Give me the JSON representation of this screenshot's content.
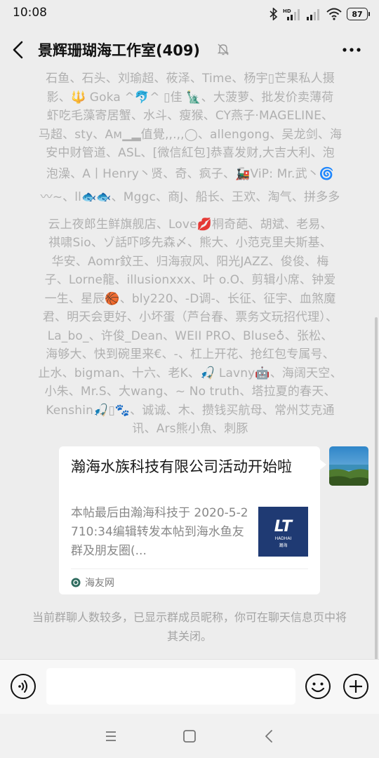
{
  "status_bar": {
    "time": "10:08",
    "battery": "87",
    "network": "HD"
  },
  "header": {
    "title": "景辉珊瑚海工作室(409)"
  },
  "members_text": [
    "石鱼、石头、刘瑜超、莜泽、Time、杨宇▯芒果私人摄",
    "影、🔱 Goka ^🐬^ ▯佳 🗽、大菠萝、批发价卖薄荷",
    "虾吃毛藻寄居蟹、水斗、瘦猴、CY燕子·MAGELINE、",
    "马超、sty、Aᴍ▁▂值覺,,.,,◯、allengong、吴龙剑、海",
    "安中财管道、ASL、[微信紅包]恭喜发财,大吉大利、泡",
    "泡澡、A丨Henry丶贤、奇、疯子、🚂ViP: Mr.武丶🌀",
    "〰~、ll🐟🐟、Mggc、商J、船长、王欢、淘气、拼多多",
    "云上夜郎生鲜旗舰店、Love💋桐奇葩、胡斌、老易、",
    "祺啸Sio、ゾ話吓哆先森〆、熊大、小范克里夫斯基、",
    "华安、Aomr鈫王、归海寂风、阳光JAZZ、俊俊、梅",
    "子、Lorne龍、illusionxxx、叶 o.O、剪辑小席、钟爱",
    "一生、星辰🏀、bly220、-D调-、长征、征宇、血煞魔",
    "君、明天会更好、小坏蛋（芦台春、票务文玩招代理）、",
    "La_bo_、许俊_Dean、WEII PRO、Bluse♁、张松、",
    "海够大、快到碗里来€、-、杠上开花、抢红包专属号、",
    "止水、bigman、十六、老K、🎣 Lavny🤖、海阔天空、",
    "小朱、Mr.S、大wang、~ No truth、塔拉夏的春天、",
    "Kenshin🎣▯🐾、诚诚、木、攒钱买航母、常州艾克通",
    "讯、Ars熊小魚、刺豚"
  ],
  "message_card": {
    "title": "瀚海水族科技有限公司活动开始啦",
    "description": "本帖最后由瀚海科技于 2020-5-2710:34编辑转发本帖到海水鱼友群及朋友圈(...",
    "thumb_logo": "LT",
    "thumb_brand": "HADHAI",
    "thumb_caption": "瀚海",
    "source": "海友网"
  },
  "notice": "当前群聊人数较多，已显示群成员昵称，你可在聊天信息页中将其关闭。",
  "input": {
    "placeholder": ""
  },
  "icons": {
    "back": "back-arrow-icon",
    "mute": "mute-bell-icon",
    "more": "more-dots-icon",
    "voice": "voice-input-icon",
    "emoji": "emoji-icon",
    "plus": "plus-icon",
    "nav_menu": "nav-menu-icon",
    "nav_home": "nav-home-icon",
    "nav_back": "nav-back-icon"
  },
  "colors": {
    "background": "#ededed",
    "member_text": "#b0b0b0",
    "card": "#ffffff",
    "thumb": "#1f3a73"
  }
}
